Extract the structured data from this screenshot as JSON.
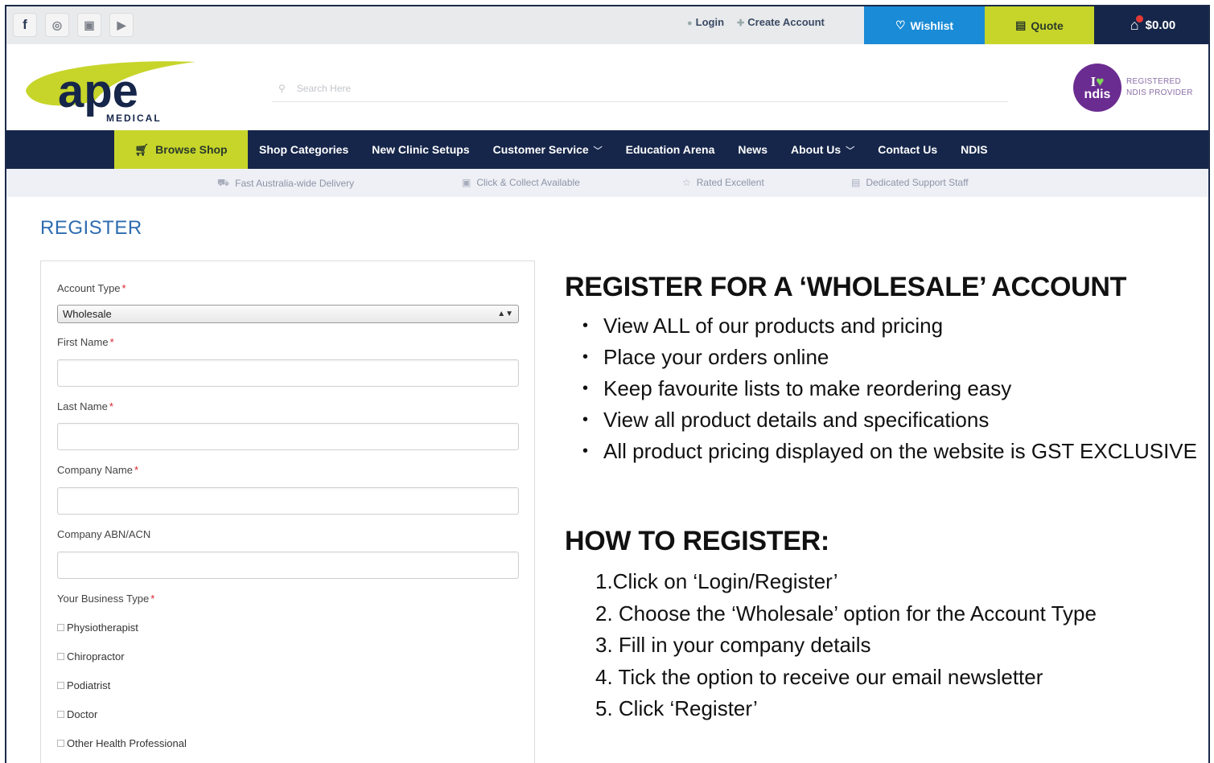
{
  "topbar": {
    "login": "Login",
    "create_account": "Create Account",
    "wishlist": "Wishlist",
    "quote": "Quote",
    "cart_total": "$0.00"
  },
  "header": {
    "logo_main": "ape",
    "logo_sub": "MEDICAL",
    "search_placeholder": "Search Here",
    "ndis_badge_top": "I",
    "ndis_badge_bottom": "ndis",
    "ndis_text": "REGISTERED NDIS PROVIDER"
  },
  "nav": {
    "browse": "Browse Shop",
    "items": [
      {
        "label": "Shop Categories"
      },
      {
        "label": "New Clinic Setups"
      },
      {
        "label": "Customer Service"
      },
      {
        "label": "Education Arena"
      },
      {
        "label": "News"
      },
      {
        "label": "About Us"
      },
      {
        "label": "Contact Us"
      },
      {
        "label": "NDIS"
      }
    ]
  },
  "features": [
    "Fast Australia-wide Delivery",
    "Click & Collect Available",
    "Rated Excellent",
    "Dedicated Support Staff"
  ],
  "page": {
    "title": "REGISTER"
  },
  "form": {
    "account_type_label": "Account Type",
    "account_type_value": "Wholesale",
    "first_name_label": "First Name",
    "last_name_label": "Last Name",
    "company_name_label": "Company Name",
    "abn_label": "Company ABN/ACN",
    "business_type_label": "Your Business Type",
    "required_mark": "*",
    "business_types": [
      "Physiotherapist",
      "Chiropractor",
      "Podiatrist",
      "Doctor",
      "Other Health Professional"
    ]
  },
  "info": {
    "heading1": "REGISTER FOR A ‘WHOLESALE’ ACCOUNT",
    "bullets": [
      "View ALL of our products and pricing",
      "Place your orders online",
      "Keep favourite lists to make reordering easy",
      "View all product details and specifications",
      "All product pricing displayed on the website is GST EXCLUSIVE"
    ],
    "heading2": "HOW TO REGISTER:",
    "steps": [
      "1.Click on ‘Login/Register’",
      "2. Choose the ‘Wholesale’ option for the Account Type",
      "3. Fill in your company details",
      "4. Tick the option to receive our email newsletter",
      "5. Click ‘Register’"
    ]
  }
}
